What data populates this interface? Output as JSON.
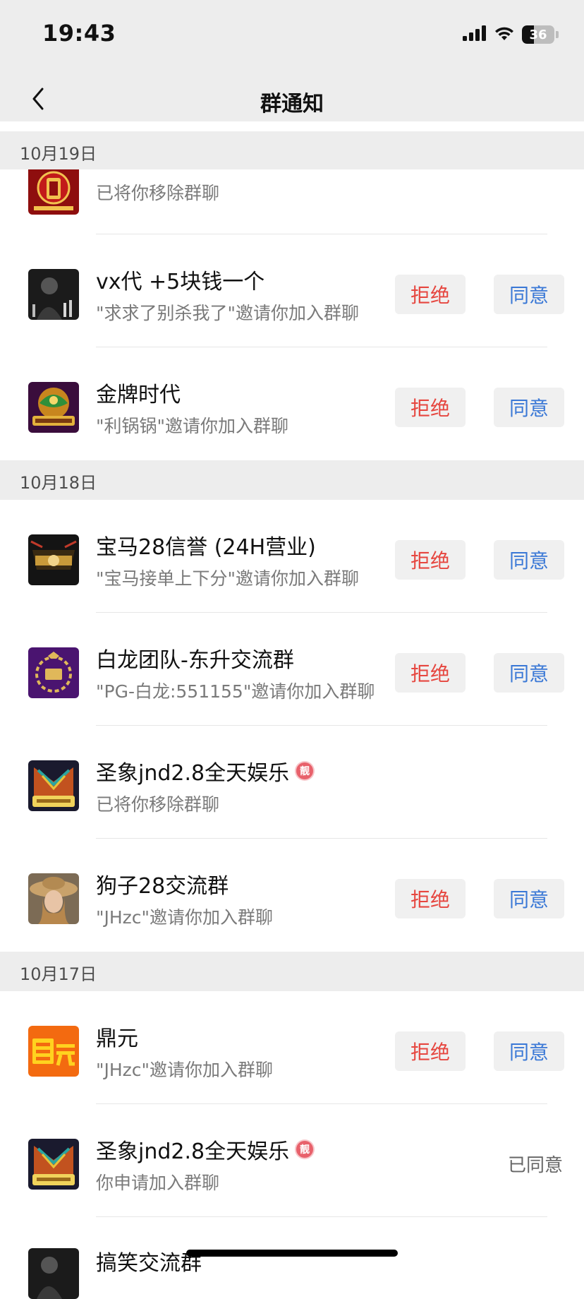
{
  "status_bar": {
    "time": "19:43",
    "battery": "36",
    "battery_level": 0.36,
    "icons": [
      "signal-icon",
      "wifi-icon",
      "battery-icon"
    ]
  },
  "navbar": {
    "title": "群通知",
    "back_icon": "chevron-left-icon"
  },
  "colors": {
    "reject_text": "#e6463f",
    "accept_text": "#3a78d6",
    "button_bg": "#f0f0f0",
    "section_bg": "#ededed",
    "badge": "#e8616b"
  },
  "sections": [
    {
      "date": "10月19日",
      "items": [
        {
          "title": "",
          "subtitle": "已将你移除群聊",
          "avatar": "red-emblem-avatar",
          "actions": false
        },
        {
          "title": "vx代 +5块钱一个",
          "subtitle": "\"求求了别杀我了\"邀请你加入群聊",
          "avatar": "dark-portrait-avatar",
          "actions": true,
          "reject": "拒绝",
          "accept": "同意"
        },
        {
          "title": "金牌时代",
          "subtitle": "\"利锅锅\"邀请你加入群聊",
          "avatar": "gold-dragon-avatar",
          "actions": true,
          "reject": "拒绝",
          "accept": "同意"
        }
      ]
    },
    {
      "date": "10月18日",
      "items": [
        {
          "title": "宝马28信誉 (24H营业)",
          "subtitle": "\"宝马接单上下分\"邀请你加入群聊",
          "avatar": "black-gold-logo-avatar",
          "actions": true,
          "reject": "拒绝",
          "accept": "同意"
        },
        {
          "title": "白龙团队-东升交流群",
          "subtitle": "\"PG-白龙:551155\"邀请你加入群聊",
          "avatar": "purple-laurel-avatar",
          "actions": true,
          "reject": "拒绝",
          "accept": "同意"
        },
        {
          "title": "圣象jnd2.8全天娱乐",
          "badge": "靓",
          "subtitle": "已将你移除群聊",
          "avatar": "colorful-elephant-avatar",
          "actions": false
        },
        {
          "title": "狗子28交流群",
          "subtitle": "\"JHzc\"邀请你加入群聊",
          "avatar": "straw-hat-portrait-avatar",
          "actions": true,
          "reject": "拒绝",
          "accept": "同意"
        }
      ]
    },
    {
      "date": "10月17日",
      "items": [
        {
          "title": "鼎元",
          "subtitle": "\"JHzc\"邀请你加入群聊",
          "avatar": "orange-dingyuan-avatar",
          "actions": true,
          "reject": "拒绝",
          "accept": "同意"
        },
        {
          "title": "圣象jnd2.8全天娱乐",
          "badge": "靓",
          "subtitle": "你申请加入群聊",
          "avatar": "colorful-elephant-avatar",
          "actions": false,
          "status": "已同意"
        },
        {
          "title": "搞笑交流群",
          "subtitle": "",
          "avatar": "dark-portrait-avatar",
          "actions": false
        }
      ]
    }
  ]
}
